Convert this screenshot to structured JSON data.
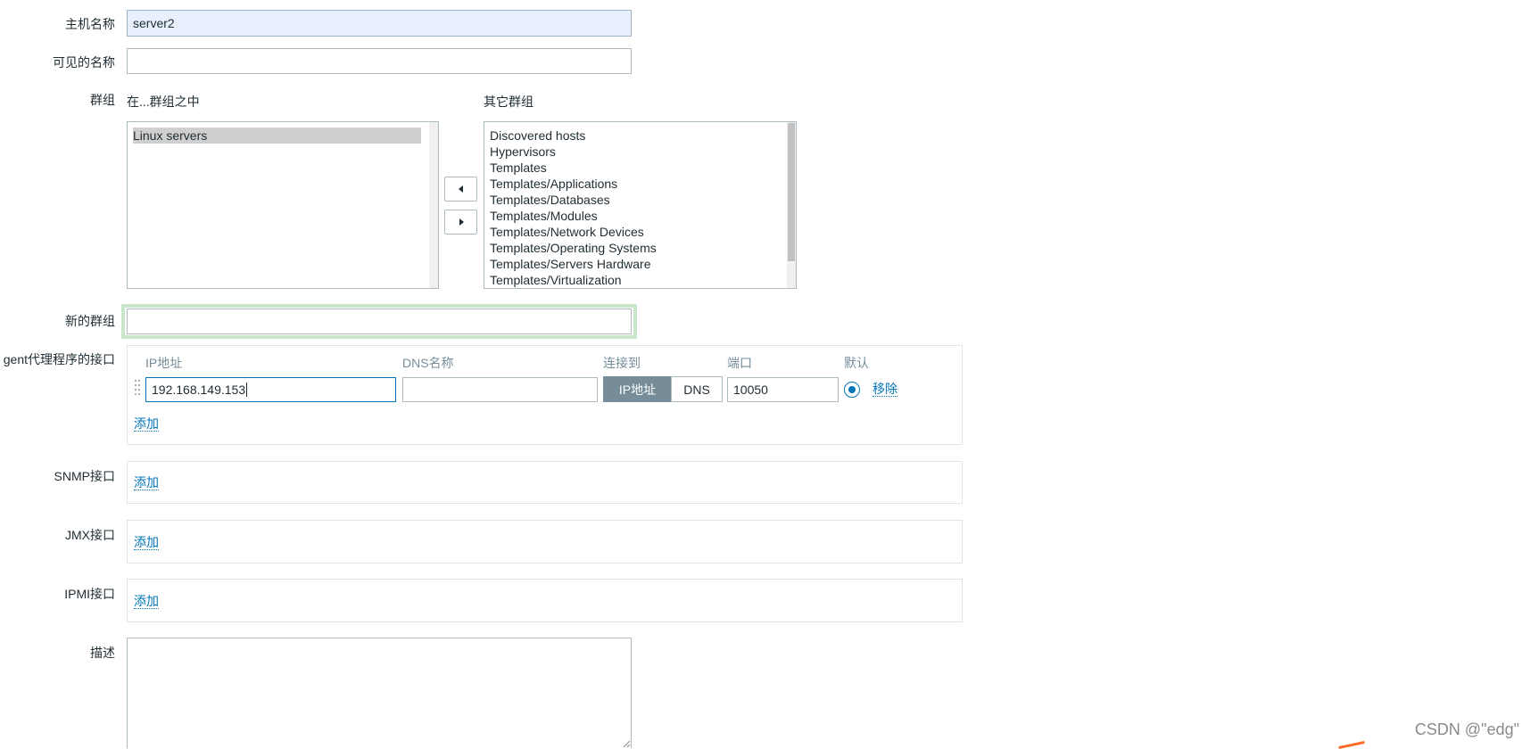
{
  "form": {
    "host_name": {
      "label": "主机名称",
      "value": "server2"
    },
    "visible_name": {
      "label": "可见的名称",
      "value": ""
    },
    "groups": {
      "label": "群组",
      "in_groups_title": "在...群组之中",
      "other_groups_title": "其它群组",
      "in_groups": [
        "Linux servers"
      ],
      "other_groups": [
        "Discovered hosts",
        "Hypervisors",
        "Templates",
        "Templates/Applications",
        "Templates/Databases",
        "Templates/Modules",
        "Templates/Network Devices",
        "Templates/Operating Systems",
        "Templates/Servers Hardware",
        "Templates/Virtualization"
      ]
    },
    "new_group": {
      "label": "新的群组",
      "value": ""
    },
    "agent_interfaces": {
      "label": "gent代理程序的接口",
      "columns": {
        "ip": "IP地址",
        "dns": "DNS名称",
        "connect_to": "连接到",
        "port": "端口",
        "default": "默认"
      },
      "row": {
        "ip": "192.168.149.153",
        "dns": "",
        "connect_ip": "IP地址",
        "connect_dns": "DNS",
        "port": "10050",
        "remove": "移除"
      },
      "add": "添加"
    },
    "snmp": {
      "label": "SNMP接口",
      "add": "添加"
    },
    "jmx": {
      "label": "JMX接口",
      "add": "添加"
    },
    "ipmi": {
      "label": "IPMI接口",
      "add": "添加"
    },
    "description": {
      "label": "描述",
      "value": ""
    }
  },
  "watermark": "CSDN @\"edg\"",
  "colors": {
    "accent": "#0275b8",
    "segment_on": "#768d99",
    "new_group_glow": "#c8e6c9"
  }
}
